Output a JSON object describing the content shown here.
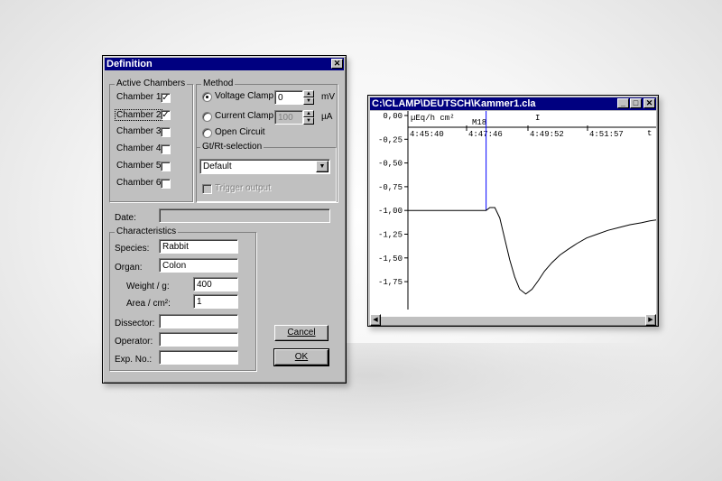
{
  "definition_dialog": {
    "title": "Definition",
    "close_glyph": "✕",
    "active_chambers": {
      "title": "Active Chambers",
      "items": [
        {
          "label": "Chamber 1",
          "checked": true
        },
        {
          "label": "Chamber 2",
          "checked": true
        },
        {
          "label": "Chamber 3",
          "checked": false
        },
        {
          "label": "Chamber 4",
          "checked": false
        },
        {
          "label": "Chamber 5",
          "checked": false
        },
        {
          "label": "Chamber 6",
          "checked": false
        }
      ]
    },
    "method": {
      "title": "Method",
      "voltage_clamp": {
        "label": "Voltage Clamp",
        "value": "0",
        "unit": "mV",
        "selected": true
      },
      "current_clamp": {
        "label": "Current Clamp",
        "value": "100",
        "unit": "µA",
        "selected": false
      },
      "open_circuit": {
        "label": "Open Circuit",
        "selected": false
      }
    },
    "gt_rt": {
      "title": "Gt/Rt-selection",
      "selected": "Default",
      "trigger_output_label": "Trigger output"
    },
    "date": {
      "label": "Date:",
      "value": ""
    },
    "characteristics": {
      "title": "Characteristics",
      "species": {
        "label": "Species:",
        "value": "Rabbit"
      },
      "organ": {
        "label": "Organ:",
        "value": "Colon"
      },
      "weight": {
        "label": "Weight / g:",
        "value": "400"
      },
      "area": {
        "label": "Area / cm²:",
        "value": "1"
      },
      "dissector": {
        "label": "Dissector:",
        "value": ""
      },
      "operator": {
        "label": "Operator:",
        "value": ""
      },
      "exp_no": {
        "label": "Exp. No.:",
        "value": ""
      }
    },
    "cancel_label": "Cancel",
    "ok_label": "OK"
  },
  "plot_window": {
    "title": "C:\\CLAMP\\DEUTSCH\\Kammer1.cla",
    "minimize_glyph": "_",
    "maximize_glyph": "□",
    "close_glyph": "✕",
    "unit_label": "µEq/h cm²",
    "marker_label": "M18",
    "cursor_label": "I",
    "time_axis_label": "t",
    "time_ticks": [
      "4:45:40",
      "4:47:46",
      "4:49:52",
      "4:51:57"
    ],
    "scroll_left": "◀",
    "scroll_right": "▶"
  },
  "chart_data": {
    "type": "line",
    "ylabel": "µEq/h cm²",
    "xlabel": "t",
    "y_ticks": [
      "0,00",
      "-0,25",
      "-0,50",
      "-0,75",
      "-1,00",
      "-1,25",
      "-1,50",
      "-1,75"
    ],
    "ylim": [
      -1.9,
      0.0
    ],
    "x_tick_labels": [
      "4:45:40",
      "4:47:46",
      "4:49:52",
      "4:51:57"
    ],
    "x_range_s": [
      0,
      400
    ],
    "marker": {
      "label": "M18",
      "x_s": 126
    },
    "series": [
      {
        "x_s": [
          0,
          40,
          80,
          126,
          132,
          140,
          148,
          156,
          164,
          172,
          180,
          190,
          200,
          210,
          220,
          232,
          245,
          258,
          272,
          288,
          305,
          322,
          340,
          358,
          376,
          390,
          400
        ],
        "values": [
          -1.0,
          -1.0,
          -1.0,
          -1.0,
          -0.97,
          -0.97,
          -1.08,
          -1.3,
          -1.52,
          -1.7,
          -1.83,
          -1.88,
          -1.83,
          -1.74,
          -1.64,
          -1.55,
          -1.47,
          -1.41,
          -1.35,
          -1.29,
          -1.25,
          -1.21,
          -1.18,
          -1.15,
          -1.13,
          -1.11,
          -1.1
        ]
      }
    ],
    "grid": false
  }
}
